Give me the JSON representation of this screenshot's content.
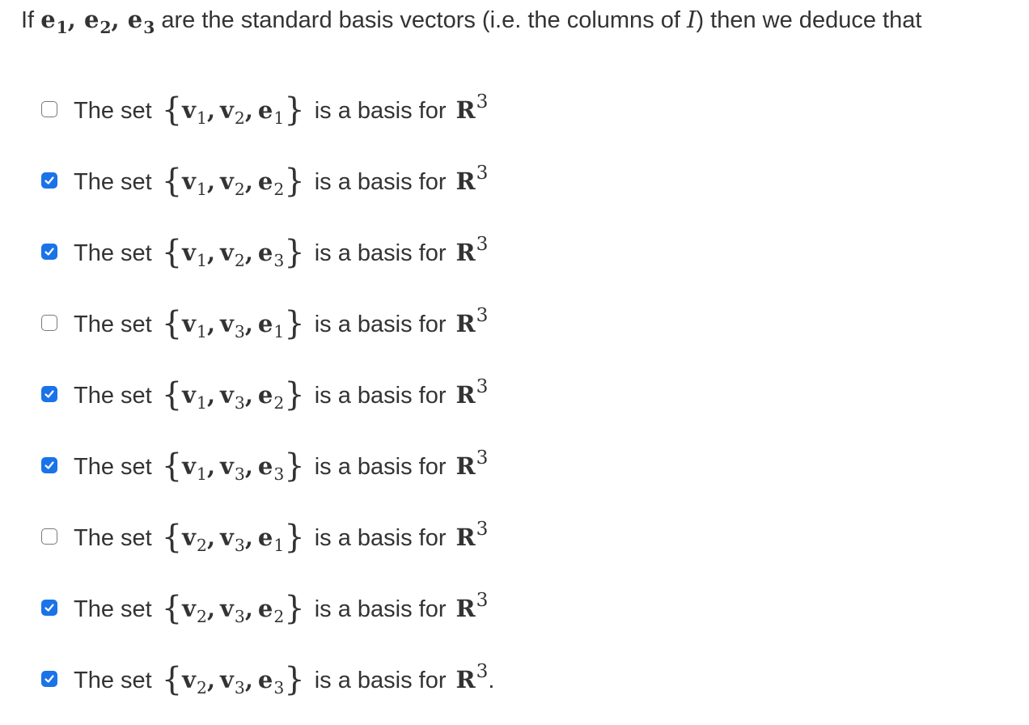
{
  "question": {
    "prefix": "If",
    "vectors": [
      {
        "letter": "e",
        "index": "1"
      },
      {
        "letter": "e",
        "index": "2"
      },
      {
        "letter": "e",
        "index": "3"
      }
    ],
    "middle": "are the standard basis vectors (i.e. the columns of",
    "matrix": "I",
    "suffix": ") then we deduce that"
  },
  "common": {
    "prefix": "The set",
    "open_brace": "{",
    "close_brace": "}",
    "suffix": "is a basis for",
    "space": "R",
    "exponent": "3",
    "separator": ","
  },
  "options": [
    {
      "checked": false,
      "vectors": [
        [
          "v",
          "1"
        ],
        [
          "v",
          "2"
        ],
        [
          "e",
          "1"
        ]
      ],
      "end": ""
    },
    {
      "checked": true,
      "vectors": [
        [
          "v",
          "1"
        ],
        [
          "v",
          "2"
        ],
        [
          "e",
          "2"
        ]
      ],
      "end": ""
    },
    {
      "checked": true,
      "vectors": [
        [
          "v",
          "1"
        ],
        [
          "v",
          "2"
        ],
        [
          "e",
          "3"
        ]
      ],
      "end": ""
    },
    {
      "checked": false,
      "vectors": [
        [
          "v",
          "1"
        ],
        [
          "v",
          "3"
        ],
        [
          "e",
          "1"
        ]
      ],
      "end": ""
    },
    {
      "checked": true,
      "vectors": [
        [
          "v",
          "1"
        ],
        [
          "v",
          "3"
        ],
        [
          "e",
          "2"
        ]
      ],
      "end": ""
    },
    {
      "checked": true,
      "vectors": [
        [
          "v",
          "1"
        ],
        [
          "v",
          "3"
        ],
        [
          "e",
          "3"
        ]
      ],
      "end": ""
    },
    {
      "checked": false,
      "vectors": [
        [
          "v",
          "2"
        ],
        [
          "v",
          "3"
        ],
        [
          "e",
          "1"
        ]
      ],
      "end": ""
    },
    {
      "checked": true,
      "vectors": [
        [
          "v",
          "2"
        ],
        [
          "v",
          "3"
        ],
        [
          "e",
          "2"
        ]
      ],
      "end": ""
    },
    {
      "checked": true,
      "vectors": [
        [
          "v",
          "2"
        ],
        [
          "v",
          "3"
        ],
        [
          "e",
          "3"
        ]
      ],
      "end": "."
    }
  ],
  "colors": {
    "checkbox_checked": "#1a73e8",
    "checkbox_border": "#7a7a7a",
    "text": "#333333"
  },
  "icons": {
    "checked": "check-icon"
  }
}
